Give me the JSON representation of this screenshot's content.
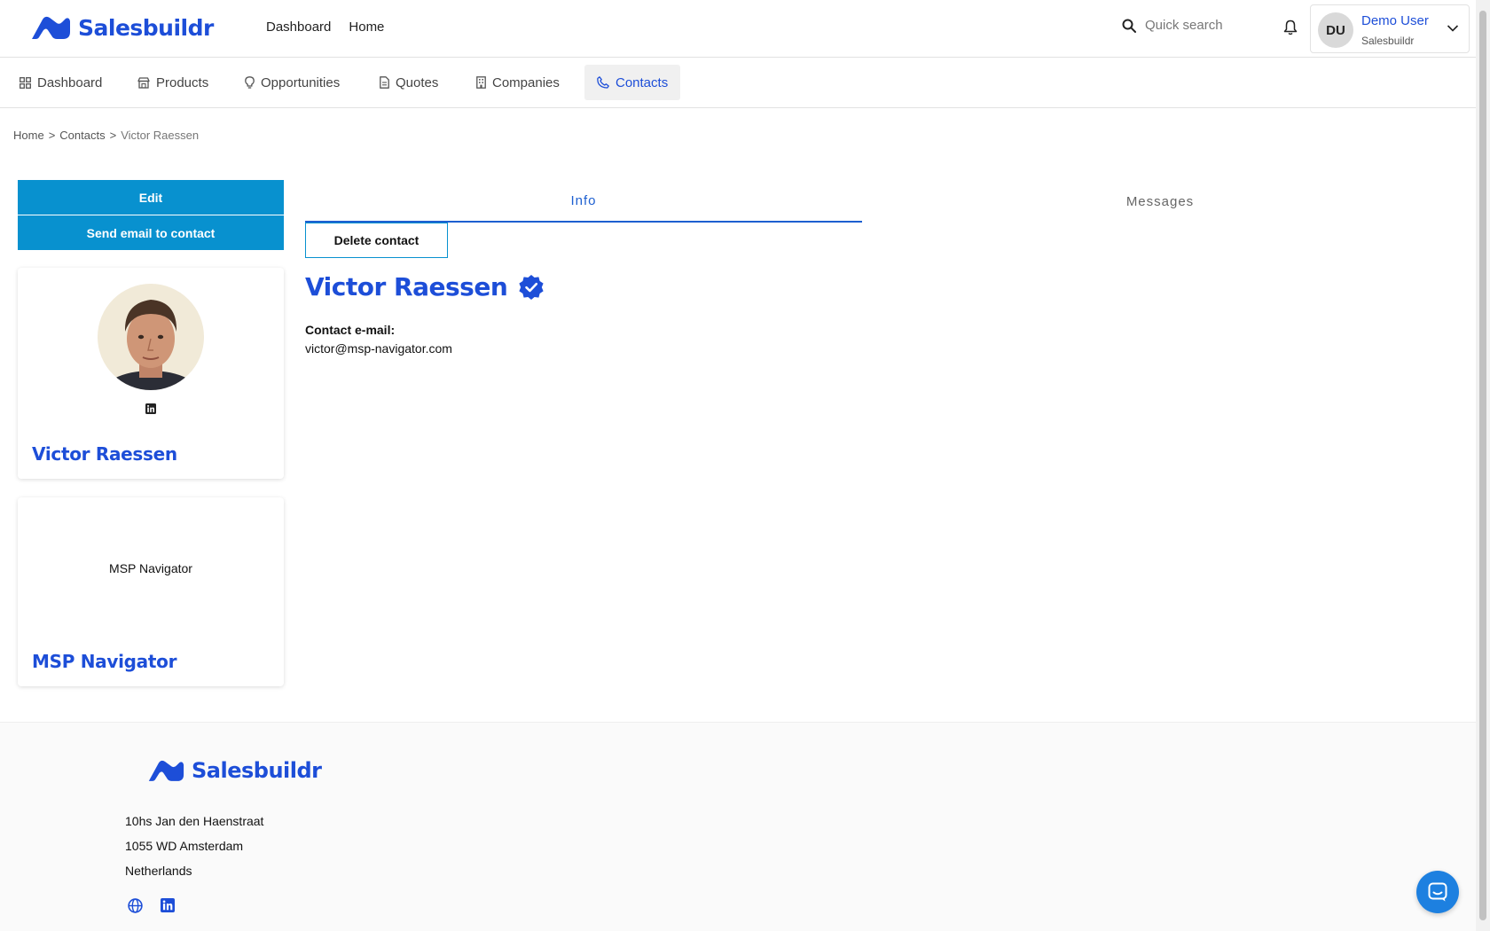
{
  "brand": {
    "name": "Salesbuildr",
    "color": "#1d4ed8",
    "accent": "#0891cf"
  },
  "topnav": {
    "dashboard": "Dashboard",
    "home": "Home"
  },
  "search": {
    "placeholder": "Quick search",
    "icon": "search-icon"
  },
  "user": {
    "initials": "DU",
    "name": "Demo User",
    "org": "Salesbuildr"
  },
  "subnav": {
    "items": [
      {
        "label": "Dashboard",
        "icon": "grid-icon"
      },
      {
        "label": "Products",
        "icon": "store-icon"
      },
      {
        "label": "Opportunities",
        "icon": "lightbulb-icon"
      },
      {
        "label": "Quotes",
        "icon": "document-icon"
      },
      {
        "label": "Companies",
        "icon": "building-icon"
      },
      {
        "label": "Contacts",
        "icon": "phone-icon",
        "active": true
      }
    ]
  },
  "breadcrumb": {
    "home": "Home",
    "sep": ">",
    "contacts": "Contacts",
    "current": "Victor Raessen"
  },
  "actions": {
    "edit": "Edit",
    "send_email": "Send email to contact",
    "delete": "Delete contact"
  },
  "profile_card": {
    "name": "Victor Raessen"
  },
  "company_card": {
    "logo_text": "MSP Navigator",
    "name": "MSP Navigator"
  },
  "tabs": {
    "info": "Info",
    "messages": "Messages"
  },
  "contact": {
    "name": "Victor Raessen",
    "email_label": "Contact e-mail:",
    "email": "victor@msp-navigator.com"
  },
  "footer": {
    "address": {
      "line1": "10hs Jan den Haenstraat",
      "line2": "1055 WD Amsterdam",
      "line3": "Netherlands"
    }
  }
}
